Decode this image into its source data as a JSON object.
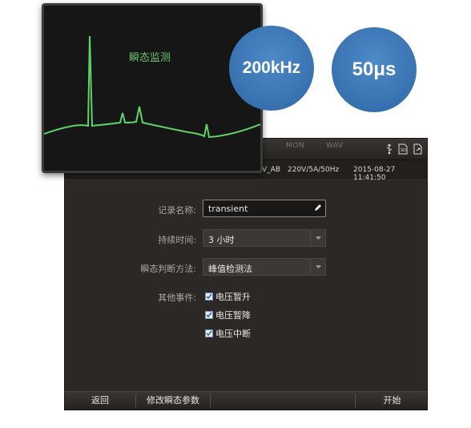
{
  "device": {
    "tabs": [
      "MON",
      "WAV"
    ],
    "info": {
      "channel": "V_AB",
      "spec": "220V/5A/50Hz",
      "datetime": "2015-08-27 11:41:50"
    },
    "form": {
      "record_name": {
        "label": "记录名称:",
        "value": "transient"
      },
      "duration": {
        "label": "持续时间:",
        "value": "3 小时"
      },
      "judgment_method": {
        "label": "瞬态判断方法:",
        "value": "峰值检测法"
      },
      "other_events": {
        "label": "其他事件:",
        "options": [
          {
            "label": "电压暂升",
            "checked": true
          },
          {
            "label": "电压暂降",
            "checked": true
          },
          {
            "label": "电压中断",
            "checked": true
          }
        ]
      }
    },
    "bottom": {
      "back": "返回",
      "modify": "修改瞬态参数",
      "start": "开始"
    },
    "icons": [
      "usb-icon",
      "sd-card-icon",
      "export-icon",
      "edit-icon",
      "dropdown-arrow-icon"
    ]
  },
  "waveform_card": {
    "title": "瞬态监测",
    "line_color": "#5fd36a"
  },
  "badges": {
    "sample_rate": "200kHz",
    "resolution": "50μs",
    "color": "#3a73b4"
  }
}
